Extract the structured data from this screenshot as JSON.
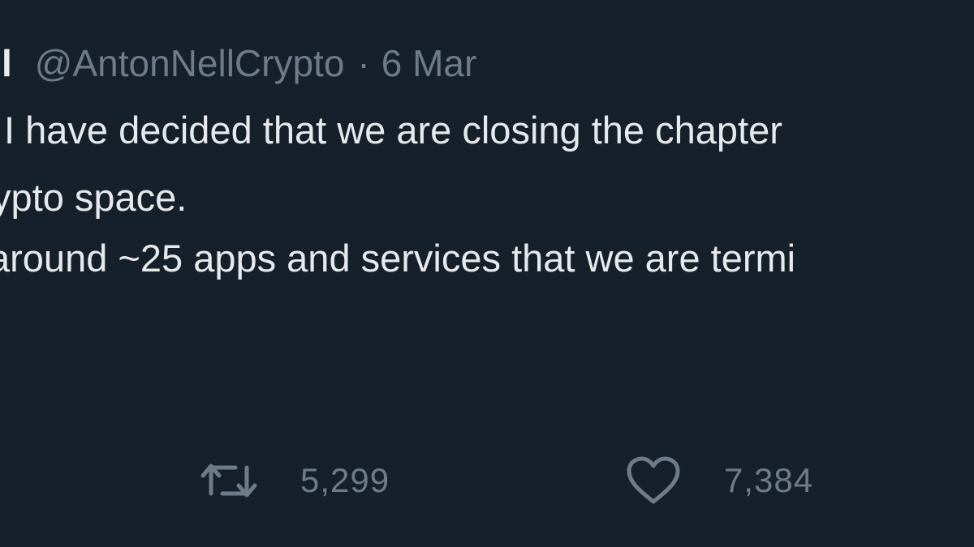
{
  "tweet": {
    "display_name_fragment": "l",
    "handle": "@AntonNellCrypto",
    "separator": "·",
    "date": "6 Mar",
    "lines": [
      "I have decided that we are closing the chapter",
      "ypto space.",
      "around ~25 apps and services that we are termi"
    ]
  },
  "actions": {
    "retweet": {
      "icon": "retweet-icon",
      "count": "5,299"
    },
    "like": {
      "icon": "heart-icon",
      "count": "7,384"
    }
  },
  "colors": {
    "background": "#15202b",
    "text": "#e7e9ea",
    "muted": "#6e7b88"
  }
}
